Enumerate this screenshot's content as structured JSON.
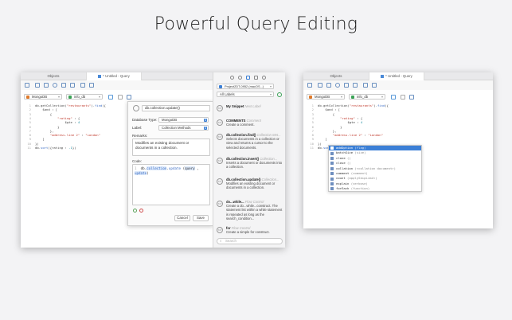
{
  "headline": "Powerful Query Editing",
  "left_window": {
    "tabs": [
      "Objects",
      "* Untitled - Query"
    ],
    "connection": "MongoDB",
    "database": "info_db",
    "code_lines": [
      {
        "n": "1",
        "parts": [
          [
            "p",
            "db.getCollection("
          ],
          [
            "s",
            "\"restaurants\""
          ],
          [
            "p",
            ")."
          ],
          [
            "k",
            "find"
          ],
          [
            "p",
            "({"
          ]
        ]
      },
      {
        "n": "2",
        "parts": [
          [
            "p",
            "    $and : ["
          ]
        ]
      },
      {
        "n": "3",
        "parts": [
          [
            "p",
            "        {"
          ]
        ]
      },
      {
        "n": "4",
        "parts": [
          [
            "s",
            "            \"rating\""
          ],
          [
            "p",
            " : {"
          ]
        ]
      },
      {
        "n": "5",
        "parts": [
          [
            "p",
            "                $gte : "
          ],
          [
            "n",
            "4"
          ]
        ]
      },
      {
        "n": "6",
        "parts": [
          [
            "p",
            "            }"
          ]
        ]
      },
      {
        "n": "7",
        "parts": [
          [
            "p",
            "        },"
          ]
        ]
      },
      {
        "n": "8",
        "parts": [
          [
            "s",
            "        \"address.line 2\""
          ],
          [
            "p",
            " : "
          ],
          [
            "s",
            "\"London\""
          ]
        ]
      },
      {
        "n": "9",
        "parts": [
          [
            "p",
            "    ]"
          ]
        ]
      },
      {
        "n": "10",
        "parts": [
          [
            "p",
            "})"
          ]
        ]
      },
      {
        "n": "11",
        "parts": [
          [
            "p",
            "db."
          ],
          [
            "k",
            "sort"
          ],
          [
            "p",
            "({rating : "
          ],
          [
            "n",
            "-1"
          ],
          [
            "p",
            "})"
          ]
        ]
      }
    ],
    "dialog": {
      "snippet_name": "db.collection.update()",
      "database_type_label": "Database Type:",
      "database_type_value": "MongoDB",
      "label_label": "Label:",
      "label_value": "Collection Methods",
      "remarks_label": "Remarks:",
      "remarks_value": "Modifies an existing document or documents in a collection.",
      "code_label": "Code:",
      "code_line_number": "1",
      "code_prefix": "db.",
      "code_collection": "collection",
      "code_dot": ".",
      "code_method": "update",
      "code_open": " (",
      "code_query": "query",
      "code_comma": " , ",
      "code_update": "update",
      "code_close": ")",
      "cancel_label": "Cancel",
      "save_label": "Save"
    },
    "panel": {
      "connection_selector": "Project2DT-0952 (macOS...)",
      "labels_selector": "All Labels",
      "search_placeholder": "Search",
      "snippets": [
        {
          "title": "My Snippet",
          "category": "Next Label",
          "desc": ""
        },
        {
          "title": "COMMENTS",
          "category": "Comment",
          "desc": "Create a comment."
        },
        {
          "title": "db.collection.find()",
          "category": "Collection Met...",
          "desc": "Selects documents in a collection or view and returns a cursor to the selected documents."
        },
        {
          "title": "db.collection.insert()",
          "category": "Collection...",
          "desc": "Inserts a document or documents into a collection."
        },
        {
          "title": "db.collection.update()",
          "category": "Collection...",
          "desc": "Modifies an existing document or documents in a collection."
        },
        {
          "title": "do...while...",
          "category": "Flow Control",
          "desc": "Create a do...while...construct. The statement list within a while statement is repeated as long as the search_condition..."
        },
        {
          "title": "for",
          "category": "Flow Control",
          "desc": "Create a simple for construct."
        }
      ]
    }
  },
  "right_window": {
    "tabs": [
      "Objects",
      "* Untitled - Query"
    ],
    "connection": "MongoDB",
    "database": "info_db",
    "code_lines": [
      {
        "n": "1",
        "parts": [
          [
            "p",
            "db.getCollection("
          ],
          [
            "s",
            "\"restaurants\""
          ],
          [
            "p",
            ")."
          ],
          [
            "k",
            "find"
          ],
          [
            "p",
            "({"
          ]
        ]
      },
      {
        "n": "2",
        "parts": [
          [
            "p",
            "    $and : ["
          ]
        ]
      },
      {
        "n": "3",
        "parts": [
          [
            "p",
            "        {"
          ]
        ]
      },
      {
        "n": "4",
        "parts": [
          [
            "s",
            "            \"rating\""
          ],
          [
            "p",
            " : {"
          ]
        ]
      },
      {
        "n": "5",
        "parts": [
          [
            "p",
            "                $gte : "
          ],
          [
            "n",
            "4"
          ]
        ]
      },
      {
        "n": "6",
        "parts": [
          [
            "p",
            "            }"
          ]
        ]
      },
      {
        "n": "7",
        "parts": [
          [
            "p",
            "        },"
          ]
        ]
      },
      {
        "n": "8",
        "parts": [
          [
            "s",
            "        \"address.line 2\""
          ],
          [
            "p",
            " : "
          ],
          [
            "s",
            "\"London\""
          ]
        ]
      },
      {
        "n": "9",
        "parts": [
          [
            "p",
            "    ]"
          ]
        ]
      },
      {
        "n": "10",
        "parts": [
          [
            "p",
            "})"
          ]
        ]
      },
      {
        "n": "11",
        "parts": [
          [
            "p",
            "db."
          ],
          [
            "k",
            "sort"
          ],
          [
            "p",
            "({rating : "
          ],
          [
            "n",
            "-1"
          ],
          [
            "p",
            "})."
          ]
        ]
      }
    ],
    "autocomplete": [
      {
        "name": "addOption",
        "sig": " (flag)"
      },
      {
        "name": "batchSize",
        "sig": " (size)"
      },
      {
        "name": "clone",
        "sig": " ()"
      },
      {
        "name": "close",
        "sig": " ()"
      },
      {
        "name": "collation",
        "sig": " (<collation document>)"
      },
      {
        "name": "comment",
        "sig": " (comment)"
      },
      {
        "name": "count",
        "sig": " (applySkipLimit)"
      },
      {
        "name": "explain",
        "sig": " (verbose)"
      },
      {
        "name": "forEach",
        "sig": " (function)"
      }
    ]
  },
  "colors": {
    "accent": "#3b7fd6",
    "string": "#c0392b",
    "keyword": "#3a6cc4",
    "number": "#1b8a9e"
  }
}
